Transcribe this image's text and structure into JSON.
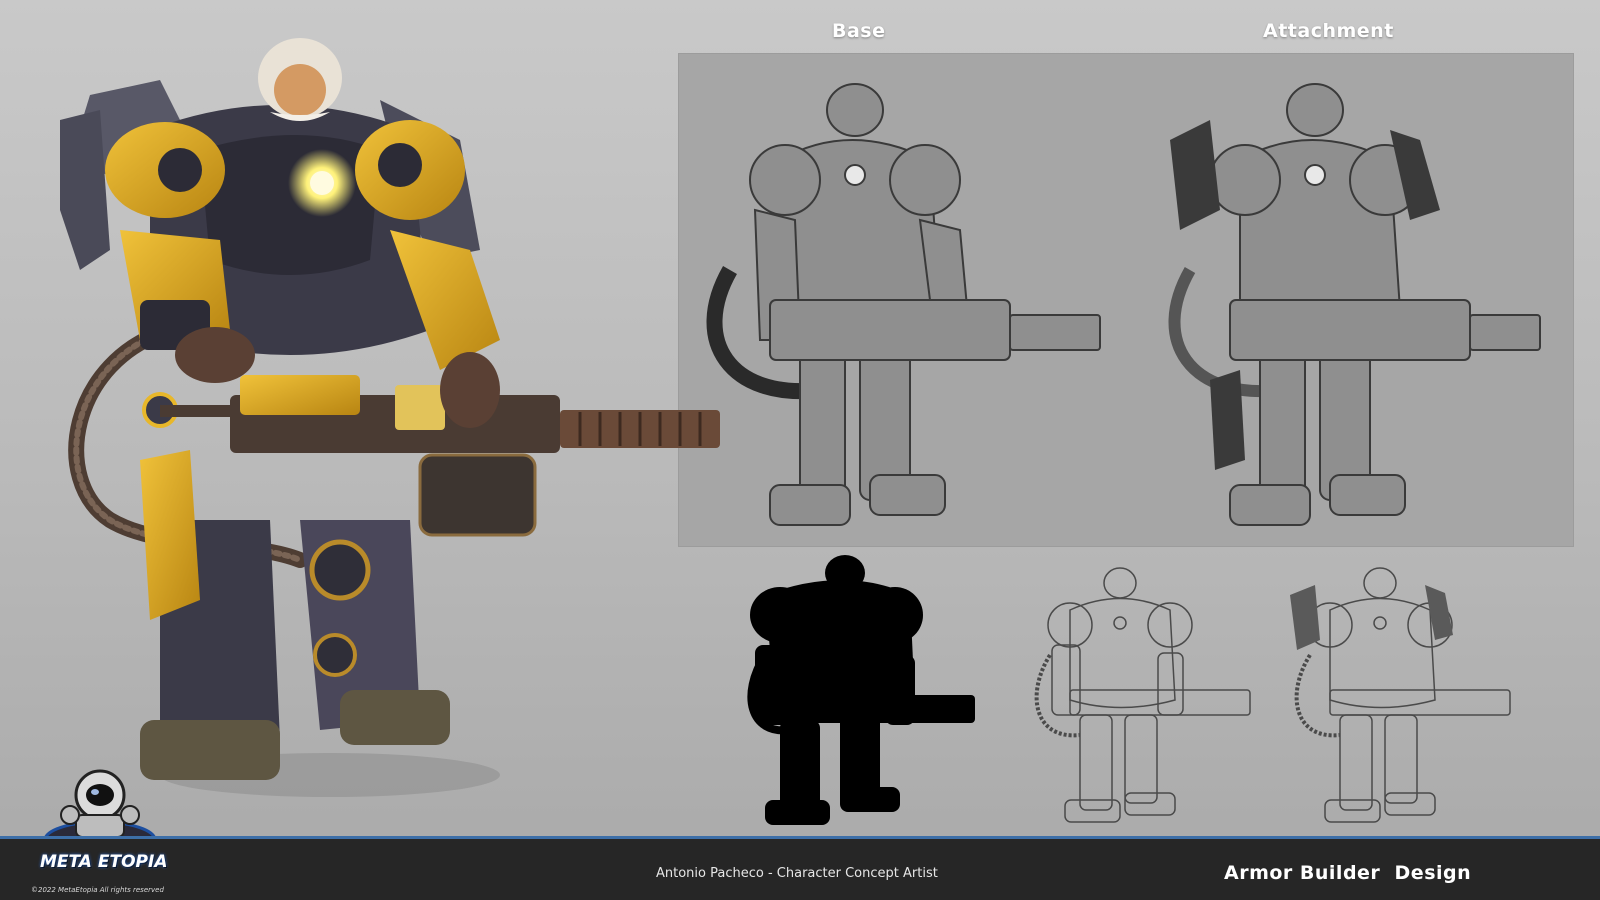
{
  "sheet": {
    "headers": {
      "base": "Base",
      "attachment": "Attachment"
    },
    "footer": {
      "credit": "Antonio Pacheco - Character Concept Artist",
      "title": "Armor Builder  Design"
    },
    "logo": {
      "name": "META ETOPIA",
      "copyright": "©2022 MetaEtopia All rights reserved"
    },
    "illustrations": {
      "main": "armored-ape-color-render",
      "base_sketch": "base-armor-sketch",
      "attachment_sketch": "attachment-armor-sketch",
      "silhouette": "silhouette",
      "lineart_base": "lineart-base",
      "lineart_attachment": "lineart-attachment"
    },
    "colors": {
      "armor_yellow": "#d9a51e",
      "armor_dark": "#3b3a48",
      "glow": "#fff27a",
      "footer_bar": "#262626",
      "footer_accent": "#3d6fa8",
      "panel": "#a6a6a6"
    }
  }
}
